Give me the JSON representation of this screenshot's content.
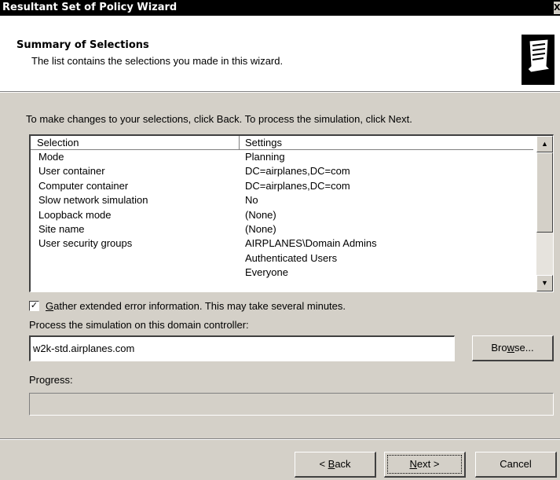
{
  "window": {
    "title": "Resultant Set of Policy Wizard",
    "close_glyph": "X"
  },
  "header": {
    "title": "Summary of Selections",
    "subtitle": "The list contains the selections you made in this wizard.",
    "icon": "scroll-document-icon"
  },
  "instructions": "To make changes to your selections, click Back. To process the simulation, click Next.",
  "selections_table": {
    "columns": [
      "Selection",
      "Settings"
    ],
    "rows": [
      {
        "selection": "Mode",
        "settings": "Planning"
      },
      {
        "selection": "User container",
        "settings": "DC=airplanes,DC=com"
      },
      {
        "selection": "Computer container",
        "settings": "DC=airplanes,DC=com"
      },
      {
        "selection": "Slow network simulation",
        "settings": "No"
      },
      {
        "selection": "Loopback mode",
        "settings": "(None)"
      },
      {
        "selection": "Site name",
        "settings": "(None)"
      },
      {
        "selection": "User security groups",
        "settings": "AIRPLANES\\Domain Admins"
      },
      {
        "selection": "",
        "settings": "Authenticated Users"
      },
      {
        "selection": "",
        "settings": "Everyone"
      }
    ]
  },
  "gather_checkbox": {
    "checked": true,
    "accel": "G",
    "label_rest": "ather extended error information. This may take several minutes."
  },
  "dc_label": "Process the simulation on this domain controller:",
  "dc_input": {
    "value": "w2k-std.airplanes.com"
  },
  "browse_button": {
    "before": "Bro",
    "accel": "w",
    "after": "se..."
  },
  "progress": {
    "label": "Progress:",
    "fraction": 0
  },
  "buttons": {
    "back": {
      "before": "< ",
      "accel": "B",
      "after": "ack"
    },
    "next": {
      "before": "",
      "accel": "N",
      "after": "ext >"
    },
    "cancel": "Cancel"
  }
}
